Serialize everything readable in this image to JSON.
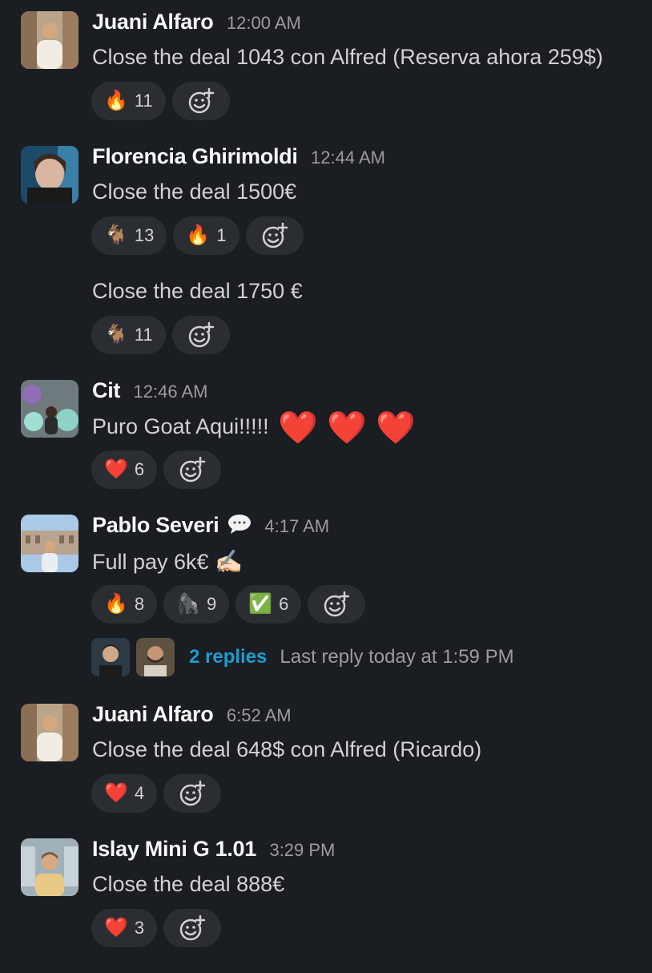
{
  "messages": [
    {
      "author": "Juani Alfaro",
      "time": "12:00 AM",
      "text": "Close the deal 1043 con Alfred (Reserva ahora 259$)",
      "reactions": [
        {
          "emoji": "🔥",
          "count": "11",
          "icon": "fire-icon"
        }
      ]
    },
    {
      "author": "Florencia Ghirimoldi",
      "time": "12:44 AM",
      "text": "Close the deal 1500€",
      "reactions": [
        {
          "emoji": "🐐",
          "count": "13",
          "icon": "goat-icon"
        },
        {
          "emoji": "🔥",
          "count": "1",
          "icon": "fire-icon"
        }
      ]
    },
    {
      "author": "",
      "time": "",
      "text": "Close the deal 1750 €",
      "reactions": [
        {
          "emoji": "🐐",
          "count": "11",
          "icon": "goat-icon"
        }
      ]
    },
    {
      "author": "Cit",
      "time": "12:46 AM",
      "text": "Puro Goat Aqui!!!!!",
      "trailing_emoji": "❤️ ❤️ ❤️",
      "reactions": [
        {
          "emoji": "❤️",
          "count": "6",
          "icon": "heart-icon"
        }
      ]
    },
    {
      "author": "Pablo Severi",
      "time": "4:17 AM",
      "status_icon": "speech-bubble-icon",
      "text": "Full pay 6k€",
      "trailing_emoji": "✍🏻",
      "reactions": [
        {
          "emoji": "🔥",
          "count": "8",
          "icon": "fire-icon"
        },
        {
          "emoji": "🦍",
          "count": "9",
          "icon": "gorilla-icon"
        },
        {
          "emoji": "✅",
          "count": "6",
          "icon": "check-icon"
        }
      ],
      "thread": {
        "replies": "2 replies",
        "last_reply": "Last reply today at 1:59 PM"
      }
    },
    {
      "author": "Juani Alfaro",
      "time": "6:52 AM",
      "text": "Close the deal 648$ con Alfred (Ricardo)",
      "reactions": [
        {
          "emoji": "❤️",
          "count": "4",
          "icon": "heart-icon"
        }
      ]
    },
    {
      "author": "Islay Mini G 1.01",
      "time": "3:29 PM",
      "text": "Close the deal 888€",
      "reactions": [
        {
          "emoji": "❤️",
          "count": "3",
          "icon": "heart-icon"
        }
      ]
    }
  ],
  "colors": {
    "background": "#1a1d21",
    "pill": "#2a2d31",
    "link": "#1d9bd1",
    "muted": "#9b9c9e"
  }
}
